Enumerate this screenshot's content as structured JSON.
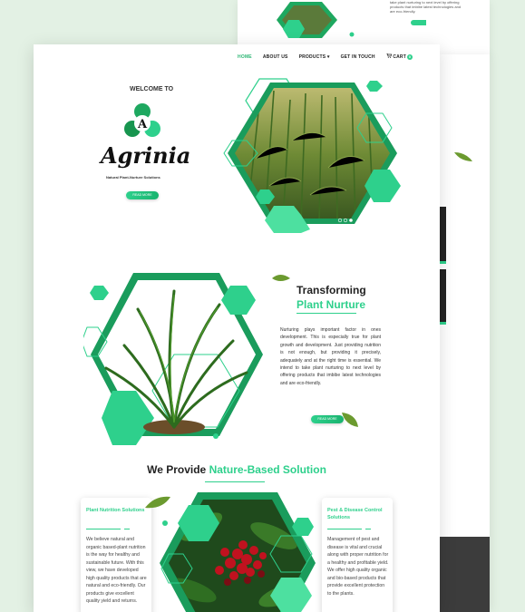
{
  "nav": {
    "items": [
      {
        "label": "HOME",
        "active": true
      },
      {
        "label": "ABOUT US",
        "active": false
      },
      {
        "label": "PRODUCTS",
        "active": false
      },
      {
        "label": "GET IN TOUCH",
        "active": false
      }
    ],
    "products_caret": "▾",
    "cart_label": "CART",
    "cart_count": "0"
  },
  "hero": {
    "welcome": "WELCOME TO",
    "brand": "Agrinia",
    "tagline": "Natural Plant-Nurture Solutions",
    "button": "READ MORE"
  },
  "transform": {
    "title": "Transforming",
    "subtitle": "Plant Nurture",
    "body": "Nurturing plays important factor in ones development. This is especially true for plant growth and development. Just providing nutrition is not enough, but providing it precisely, adequately and at the right time is essential. We intend to take plant nurturing to next level by offering products that imbibe latest technologies and are eco-friendly.",
    "button": "READ MORE"
  },
  "provide": {
    "title_prefix": "We Provide",
    "title_accent": "Nature-Based Solution"
  },
  "services": [
    {
      "title": "Plant Nutrition Solutions",
      "body": "We believe natural and organic based-plant nutrition is the way for healthy and sustainable future. With this view, we have developed high quality products that are natural and eco-friendly. Our products give excellent quality yield and returns."
    },
    {
      "title": "Pest & Disease Control Solutions",
      "body": "Management of pest and disease is vital and crucial along with proper nutrition for a healthy and profitable yield. We offer high quality organic and bio-based products that provide excellent protection to the plants."
    }
  ],
  "background_snippet": "take plant nurturing to next level by offering products that imbibe latest technologies and are eco-friendly.",
  "colors": {
    "accent": "#2ed08c",
    "accent_dark": "#1a9c5c",
    "text": "#222222"
  }
}
